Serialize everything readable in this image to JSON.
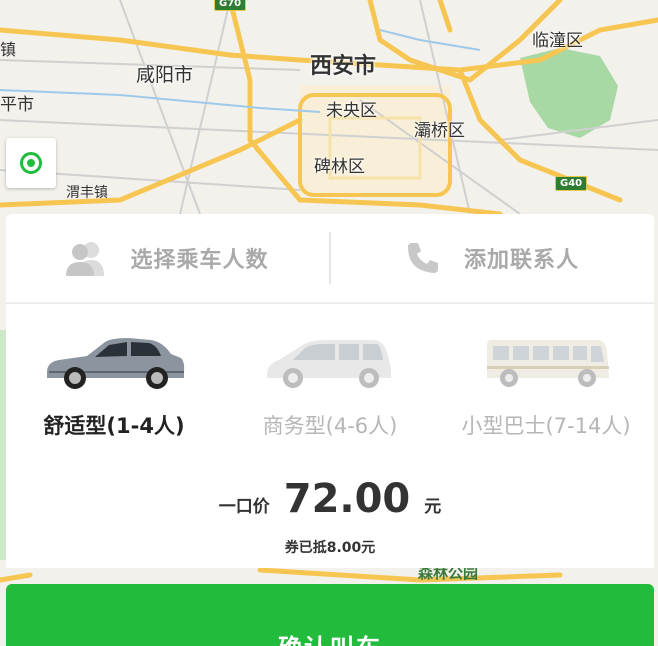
{
  "colors": {
    "accent_green": "#22bb3b",
    "map_background": "#f3f1ec",
    "road_yellow": "#f7c652",
    "muted_text": "#a9a9a9"
  },
  "map": {
    "labels": {
      "xian": "西安市",
      "xianyang": "咸阳市",
      "weiyang": "未央区",
      "beilin": "碑林区",
      "baqiao": "灞桥区",
      "lintong": "临潼区",
      "weifeng": "渭丰镇",
      "pingshi": "平市",
      "zhen": "镇",
      "park": "森林公园"
    },
    "road_badges": {
      "g70": "G70",
      "g40": "G40"
    },
    "locate_icon": "locate-icon"
  },
  "options": {
    "passengers": {
      "icon": "people-icon",
      "label": "选择乘车人数"
    },
    "contact": {
      "icon": "phone-icon",
      "label": "添加联系人"
    }
  },
  "cars": [
    {
      "icon": "sedan-icon",
      "label": "舒适型(1-4人)",
      "selected": true
    },
    {
      "icon": "minivan-icon",
      "label": "商务型(4-6人)",
      "selected": false
    },
    {
      "icon": "minibus-icon",
      "label": "小型巴士(7-14人)",
      "selected": false
    }
  ],
  "price": {
    "prefix": "一口价",
    "value": "72.00",
    "unit": "元",
    "coupon": "券已抵8.00元"
  },
  "confirm_label": "确认叫车"
}
